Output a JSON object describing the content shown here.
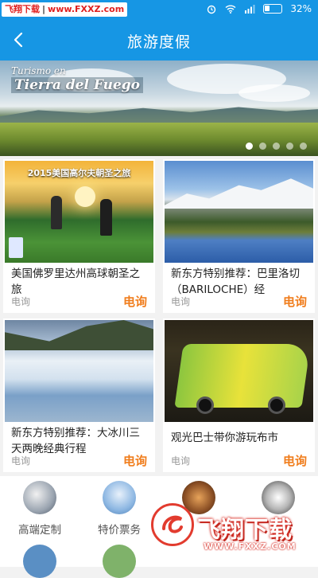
{
  "status_bar": {
    "watermark_site": "飞翔下载",
    "watermark_url": "www.FXXZ.com",
    "battery": "32%"
  },
  "header": {
    "title": "旅游度假"
  },
  "banner": {
    "line1": "Turismo en",
    "line2": "Tierra del Fuego",
    "slide_count": 5,
    "active_slide": 1
  },
  "products": [
    {
      "image_title": "2015美国高尔夫朝圣之旅",
      "name": "美国佛罗里达州高球朝圣之旅",
      "tag": "电询",
      "price": "电询"
    },
    {
      "name": "新东方特别推荐：巴里洛切（BARILOCHE）经",
      "tag": "电询",
      "price": "电询"
    },
    {
      "name": "新东方特别推荐：大冰川三天两晚经典行程",
      "tag": "电询",
      "price": "电询"
    },
    {
      "name": "观光巴士带你游玩布市",
      "tag": "电询",
      "price": "电询"
    }
  ],
  "categories": [
    {
      "label": "高端定制",
      "icon": "business-people-icon"
    },
    {
      "label": "特价票务",
      "icon": "airplane-icon"
    },
    {
      "label": "",
      "icon": "food-icon"
    },
    {
      "label": "",
      "icon": "penguin-icon"
    }
  ],
  "overlay_watermark": {
    "name": "飞翔下载",
    "url": "WWW.FXXZ.COM"
  },
  "colors": {
    "primary": "#1696e4",
    "price": "#f07d1c",
    "watermark_red": "#e02020"
  }
}
